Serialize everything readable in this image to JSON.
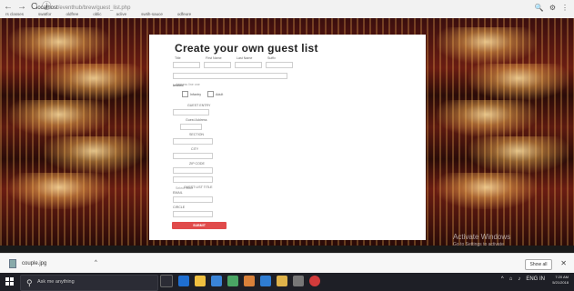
{
  "browser": {
    "back_icon": "←",
    "forward_icon": "→",
    "reload_icon": "C",
    "info_icon": "ⓘ",
    "url_host": "localhost",
    "url_path": "/eventhub/brew/guest_list.php",
    "bookmarks": [
      "rs classes",
      "swatfor",
      "oldfree",
      "oblic",
      "aclive",
      "swtih-sauce",
      "odfeure"
    ]
  },
  "form": {
    "title": "Create your own guest list",
    "first_labels": [
      "Title",
      "First Name",
      "Last Name",
      "Suffix"
    ],
    "address_placeholder": "Address line one",
    "section_label": "Invited",
    "check_left": "Infantry",
    "check_right": "Adult",
    "label_a": "GUEST ENTRY",
    "label_b": "Guest Address",
    "label_c": "SECTION",
    "label_d": "CITY",
    "label_e": "ZIP CODE",
    "select_placeholder": "Select State",
    "label_f": "GUEST LIST TITLE",
    "label_g": "EMAIL",
    "label_h": "CIRCLE",
    "submit_label": "SUBMIT"
  },
  "downloads": {
    "file_name": "couple.jpg",
    "caret": "^",
    "show_all": "Show all",
    "close_icon": "✕"
  },
  "watermark": {
    "line1": "Activate Windows",
    "line2": "Go to Settings to activate"
  },
  "taskbar": {
    "search_placeholder": "Ask me anything",
    "search_icon": "⚲",
    "notification_icon": "▢",
    "tray_caret": "^",
    "tray_lang": "ENG",
    "tray_locale": "IN",
    "clock_time": "7:20 AM",
    "clock_date": "5/21/2018"
  },
  "colors": {
    "accent": "#e04b4b",
    "taskbar_bg": "#1e1f26"
  }
}
